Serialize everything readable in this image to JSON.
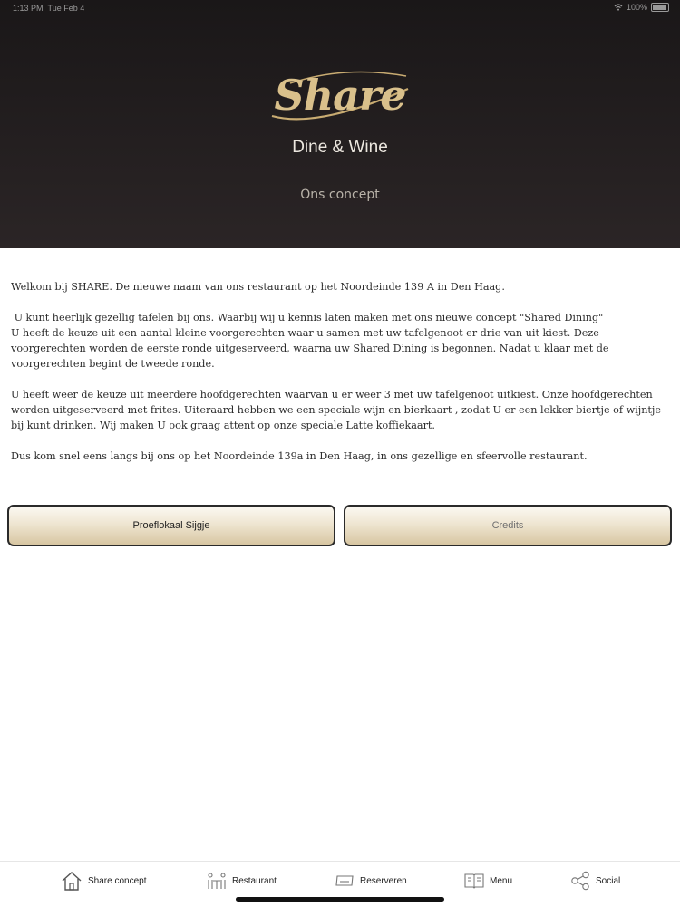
{
  "status_bar": {
    "time": "1:13 PM",
    "date": "Tue Feb 4",
    "battery": "100%"
  },
  "header": {
    "logo": "Share",
    "tagline": "Dine & Wine",
    "subtitle": "Ons concept"
  },
  "content": {
    "paragraphs": [
      "Welkom bij SHARE. De nieuwe naam van ons restaurant op het Noordeinde 139 A in Den Haag.",
      " U kunt heerlijk gezellig tafelen bij ons. Waarbij wij u kennis laten maken met ons nieuwe concept \"Shared Dining\"\nU heeft de keuze uit een aantal kleine voorgerechten waar u samen met uw tafelgenoot er drie van uit kiest. Deze voorgerechten worden de eerste ronde uitgeserveerd, waarna uw Shared Dining is begonnen. Nadat u klaar met de voorgerechten begint de tweede ronde.",
      "U heeft weer de keuze uit meerdere hoofdgerechten waarvan u er weer 3 met uw tafelgenoot uitkiest. Onze hoofdgerechten worden uitgeserveerd met frites. Uiteraard hebben we een speciale wijn en bierkaart , zodat U er een lekker biertje of wijntje bij kunt drinken. Wij maken U ook graag attent op onze speciale Latte koffiekaart.",
      "Dus kom snel eens langs bij ons op het Noordeinde 139a in Den Haag, in ons gezellige en sfeervolle restaurant."
    ]
  },
  "buttons": {
    "left_label": "Proeflokaal Sijgje",
    "right_label": "Credits"
  },
  "tabs": [
    {
      "label": "Share concept",
      "icon": "home-icon"
    },
    {
      "label": "Restaurant",
      "icon": "dining-table-icon"
    },
    {
      "label": "Reserveren",
      "icon": "ticket-icon"
    },
    {
      "label": "Menu",
      "icon": "menu-book-icon"
    },
    {
      "label": "Social",
      "icon": "share-icon"
    }
  ],
  "colors": {
    "header_bg": "#231e1f",
    "logo_gold": "#d9c08b",
    "button_gradient_bottom": "#d8c6a2"
  }
}
